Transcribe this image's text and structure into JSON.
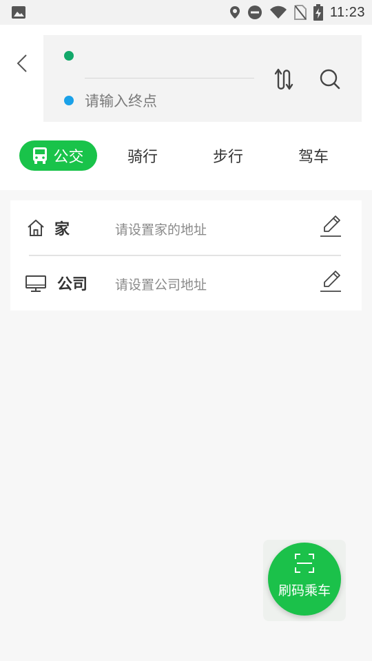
{
  "status_bar": {
    "time": "11:23",
    "icons": [
      "image-icon",
      "location-icon",
      "do-not-disturb-icon",
      "wifi-icon",
      "no-sim-icon",
      "battery-charging-icon"
    ]
  },
  "route": {
    "start_value": "",
    "end_placeholder": "请输入终点",
    "start_dot_color": "#12a86a",
    "end_dot_color": "#1aa1e8"
  },
  "tabs": [
    {
      "label": "公交",
      "icon": "bus-icon",
      "active": true
    },
    {
      "label": "骑行",
      "active": false
    },
    {
      "label": "步行",
      "active": false
    },
    {
      "label": "驾车",
      "active": false
    }
  ],
  "addresses": [
    {
      "name": "家",
      "hint": "请设置家的地址",
      "icon": "home-icon"
    },
    {
      "name": "公司",
      "hint": "请设置公司地址",
      "icon": "monitor-icon"
    }
  ],
  "fab": {
    "label": "刷码乘车",
    "icon": "scan-icon"
  },
  "colors": {
    "accent": "#19c34a",
    "background": "#f7f7f7"
  }
}
